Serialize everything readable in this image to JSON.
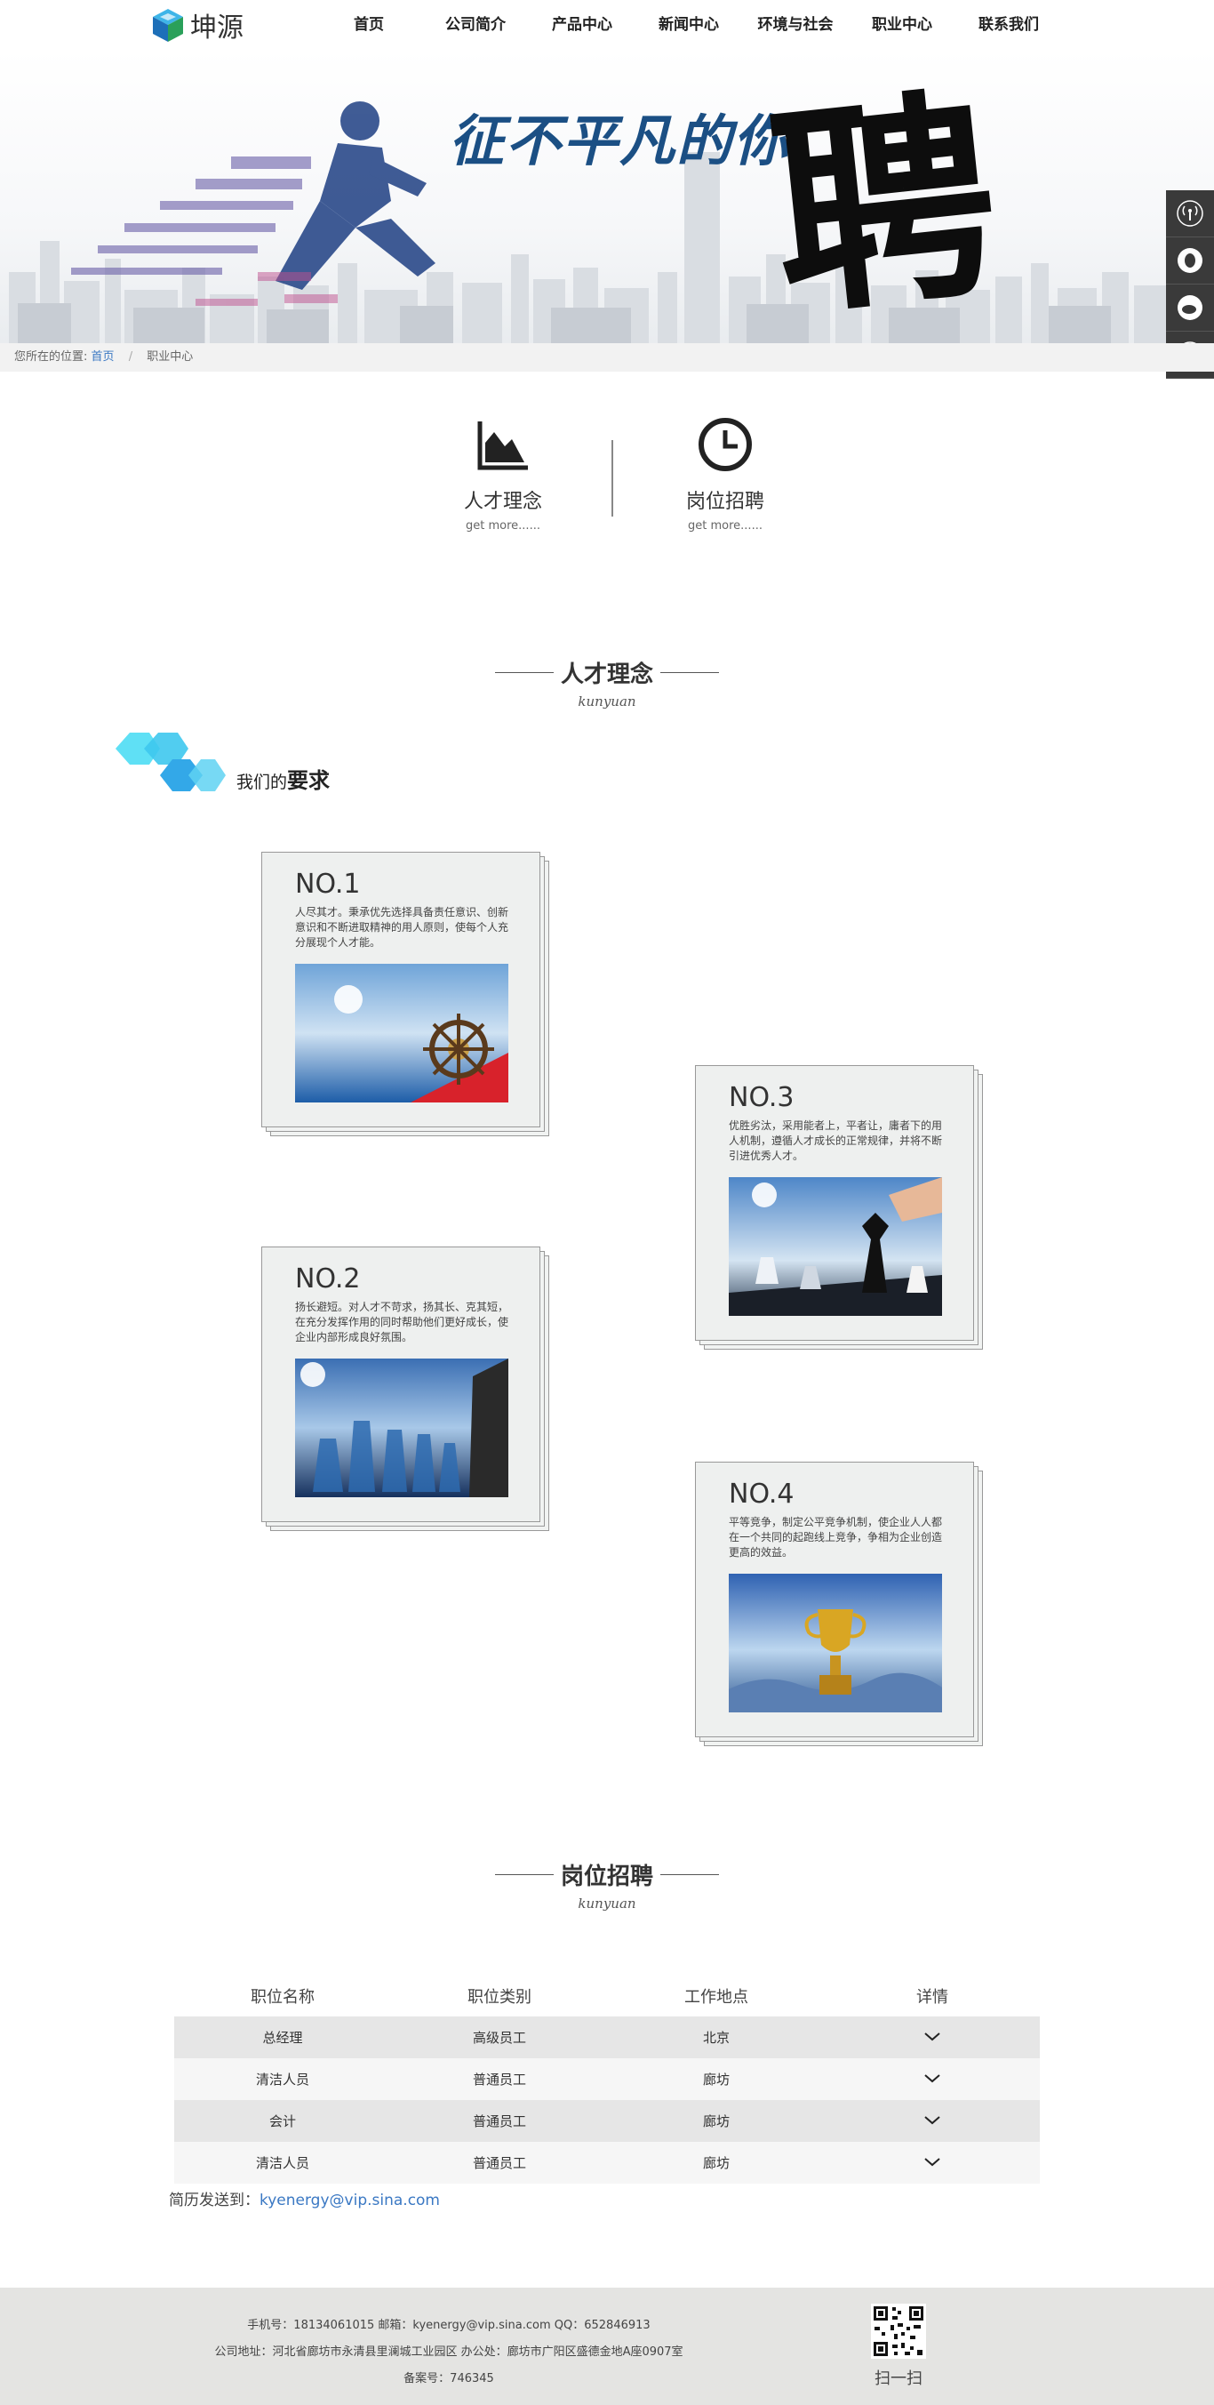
{
  "header": {
    "logo_text": "坤源",
    "nav": [
      "首页",
      "公司简介",
      "产品中心",
      "新闻中心",
      "环境与社会",
      "职业中心",
      "联系我们"
    ]
  },
  "banner": {
    "slogan": "征不平凡的你",
    "big_char": "聘"
  },
  "sidebar": {
    "icons": [
      "signal-icon",
      "qq-icon",
      "weibo-icon",
      "back-to-top-icon"
    ]
  },
  "breadcrumb": {
    "label": "您所在的位置:",
    "home": "首页",
    "sep": "/",
    "current": "职业中心"
  },
  "tabs": [
    {
      "title": "人才理念",
      "more": "get more......",
      "icon": "area-chart-icon"
    },
    {
      "title": "岗位招聘",
      "more": "get more......",
      "icon": "clock-icon"
    }
  ],
  "talent": {
    "title": "人才理念",
    "subtitle": "kunyuan",
    "req_prefix": "我们的",
    "req_bold": "要求"
  },
  "cards": [
    {
      "num": "NO.1",
      "desc": "人尽其才。秉承优先选择具备责任意识、创新意识和不断进取精神的用人原则，使每个人充分展现个人才能。",
      "image": "ship-wheel-sea"
    },
    {
      "num": "NO.2",
      "desc": "扬长避短。对人才不苛求，扬其长、克其短，在充分发挥作用的同时帮助他们更好成长，使企业内部形成良好氛围。",
      "image": "glass-chess-pieces"
    },
    {
      "num": "NO.3",
      "desc": "优胜劣汰，采用能者上，平者让，庸者下的用人机制，遵循人才成长的正常规律，并将不断引进优秀人才。",
      "image": "chess-hand"
    },
    {
      "num": "NO.4",
      "desc": "平等竞争，制定公平竞争机制，使企业人人都在一个共同的起跑线上竞争，争相为企业创造更高的效益。",
      "image": "gold-trophy"
    }
  ],
  "jobs": {
    "title": "岗位招聘",
    "subtitle": "kunyuan",
    "headers": [
      "职位名称",
      "职位类别",
      "工作地点",
      "详情"
    ],
    "rows": [
      [
        "总经理",
        "高级员工",
        "北京"
      ],
      [
        "清洁人员",
        "普通员工",
        "廊坊"
      ],
      [
        "会计",
        "普通员工",
        "廊坊"
      ],
      [
        "清洁人员",
        "普通员工",
        "廊坊"
      ]
    ],
    "resume_label": "简历发送到：",
    "resume_email": "kyenergy@vip.sina.com"
  },
  "footer": {
    "line1": "手机号：18134061015    邮箱：kyenergy@vip.sina.com    QQ：652846913",
    "line2": "公司地址：河北省廊坊市永清县里澜城工业园区    办公处：廊坊市广阳区盛德金地A座0907室",
    "line3": "备案号：746345",
    "qr_label": "扫一扫"
  },
  "colors": {
    "accent": "#3a78c3",
    "side_bar": "#3a3a3a",
    "footer_bg": "#e4e4e2"
  }
}
